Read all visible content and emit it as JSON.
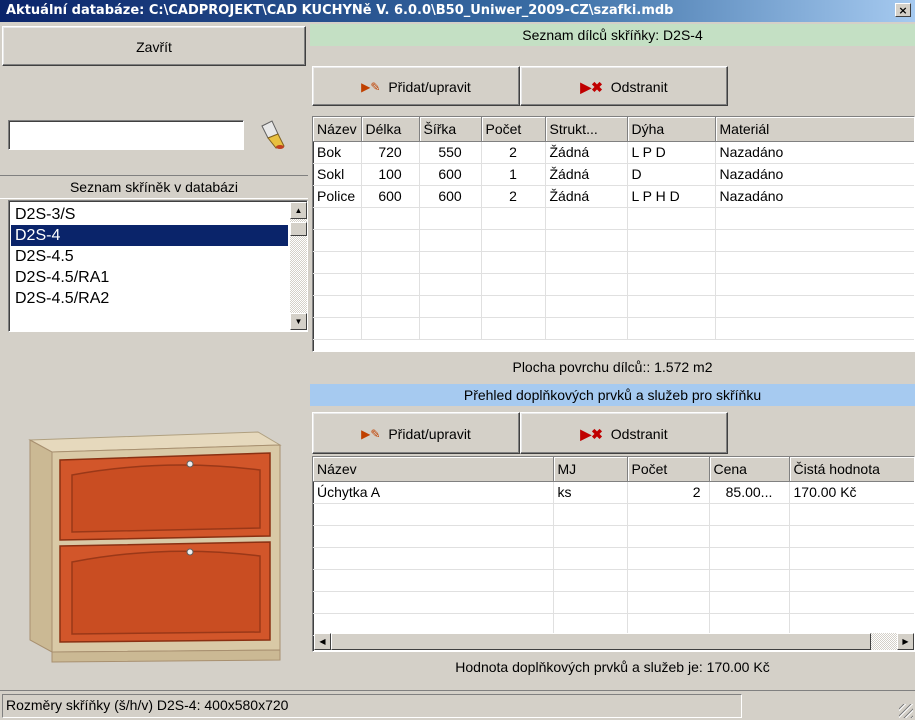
{
  "window": {
    "title": "Aktuální databáze: C:\\CADPROJEKT\\CAD KUCHYNě V. 6.0.0\\B50_Uniwer_2009-CZ\\szafki.mdb",
    "close_glyph": "×"
  },
  "left": {
    "close_label": "Zavřít",
    "search_value": "",
    "list_header": "Seznam skříněk v databázi",
    "cabinets": [
      "D2S-3/S",
      "D2S-4",
      "D2S-4.5",
      "D2S-4.5/RA1",
      "D2S-4.5/RA2"
    ],
    "selected_index": 1
  },
  "parts": {
    "header": "Seznam dílců skříňky: D2S-4",
    "add_label": "Přidat/upravit",
    "remove_label": "Odstranit",
    "columns": [
      "Název",
      "Délka",
      "Šířka",
      "Počet",
      "Strukt...",
      "Dýha",
      "Materiál"
    ],
    "rows": [
      [
        "Bok",
        "720",
        "550",
        "2",
        "Žádná",
        "L P D",
        "Nazadáno"
      ],
      [
        "Sokl",
        "100",
        "600",
        "1",
        "Žádná",
        "D",
        "Nazadáno"
      ],
      [
        "Police",
        "600",
        "600",
        "2",
        "Žádná",
        "L P H D",
        "Nazadáno"
      ]
    ],
    "area_text": "Plocha povrchu dílců:: 1.572 m2"
  },
  "extras": {
    "header": "Přehled doplňkových prvků a služeb pro skříňku",
    "add_label": "Přidat/upravit",
    "remove_label": "Odstranit",
    "columns": [
      "Název",
      "MJ",
      "Počet",
      "Cena",
      "Čistá hodnota"
    ],
    "rows": [
      [
        "Úchytka A",
        "ks",
        "2",
        "85.00...",
        "170.00 Kč"
      ]
    ],
    "total_text": "Hodnota doplňkových prvků a služeb je: 170.00 Kč"
  },
  "status": {
    "text": "Rozměry skříňky (š/h/v) D2S-4: 400x580x720"
  },
  "colors": {
    "accent": "#0a246a",
    "extras_header_bg": "#a6caf0",
    "parts_header_bg": "#c4e0c4",
    "cabinet_front": "#d2562a",
    "cabinet_body": "#d9c9a6"
  }
}
